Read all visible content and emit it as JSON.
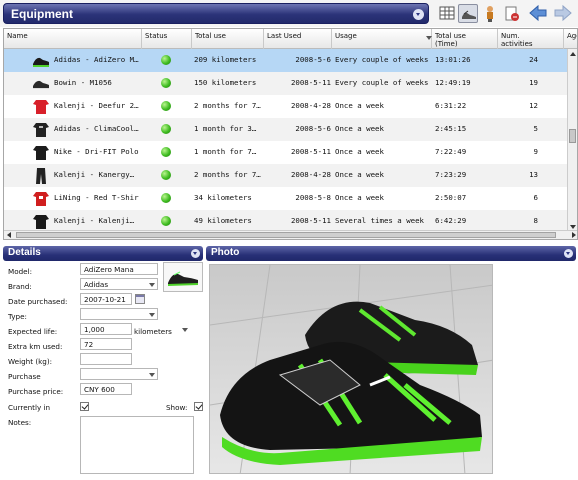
{
  "header": {
    "title": "Equipment",
    "toolbar_icons": [
      "table-view-icon",
      "shoe-view-icon",
      "person-icon",
      "document-edit-icon",
      "back-arrow-icon",
      "forward-arrow-icon"
    ]
  },
  "table": {
    "columns": [
      "Name",
      "Status",
      "Total use",
      "Last Used",
      "Usage",
      "Total use\n(Time)",
      "Num.\nactivities",
      "Age"
    ],
    "rows": [
      {
        "name": "Adidas - AdiZero M…",
        "total": "209 kilometers",
        "last": "2008-5-6",
        "usage": "Every couple of weeks",
        "time": "13:01:26",
        "acts": "24",
        "selected": true
      },
      {
        "name": "Bowin - M1056",
        "total": "150 kilometers",
        "last": "2008-5-11",
        "usage": "Every couple of weeks",
        "time": "12:49:19",
        "acts": "19",
        "selected": false
      },
      {
        "name": "Kalenji - Deefur 2…",
        "total": "2 months for 7…",
        "last": "2008-4-28",
        "usage": "Once a week",
        "time": "6:31:22",
        "acts": "12",
        "selected": false
      },
      {
        "name": "Adidas - ClimaCool…",
        "total": "1 month for 3…",
        "last": "2008-5-6",
        "usage": "Once a week",
        "time": "2:45:15",
        "acts": "5",
        "selected": false
      },
      {
        "name": "Nike - Dri-FIT Polo",
        "total": "1 month for 7…",
        "last": "2008-5-11",
        "usage": "Once a week",
        "time": "7:22:49",
        "acts": "9",
        "selected": false
      },
      {
        "name": "Kalenji - Kanergy…",
        "total": "2 months for 7…",
        "last": "2008-4-28",
        "usage": "Once a week",
        "time": "7:23:29",
        "acts": "13",
        "selected": false
      },
      {
        "name": "LiNing - Red T-Shirt",
        "total": "34 kilometers",
        "last": "2008-5-8",
        "usage": "Once a week",
        "time": "2:50:07",
        "acts": "6",
        "selected": false
      },
      {
        "name": "Kalenji - Kalenji…",
        "total": "49 kilometers",
        "last": "2008-5-11",
        "usage": "Several times a week",
        "time": "6:42:29",
        "acts": "8",
        "selected": false
      }
    ]
  },
  "details": {
    "title": "Details",
    "model_label": "Model:",
    "model": "AdiZero Mana",
    "brand_label": "Brand:",
    "brand": "Adidas",
    "date_label": "Date purchased:",
    "date": "2007-10-21",
    "type_label": "Type:",
    "type": "",
    "life_label": "Expected life:",
    "life": "1,000",
    "life_unit": "kilometers",
    "extra_label": "Extra km used:",
    "extra": "72",
    "weight_label": "Weight (kg):",
    "weight": "",
    "purchase_label": "Purchase",
    "purchase": "",
    "price_label": "Purchase price:",
    "price": "CNY 600",
    "current_label": "Currently in",
    "current": true,
    "show_label": "Show:",
    "show": true,
    "notes_label": "Notes:",
    "notes": ""
  },
  "photo": {
    "title": "Photo"
  },
  "colors": {
    "header_bar": "#2b3379",
    "selected_row": "#b6d7f5",
    "status_green": "#3dbb1f"
  }
}
